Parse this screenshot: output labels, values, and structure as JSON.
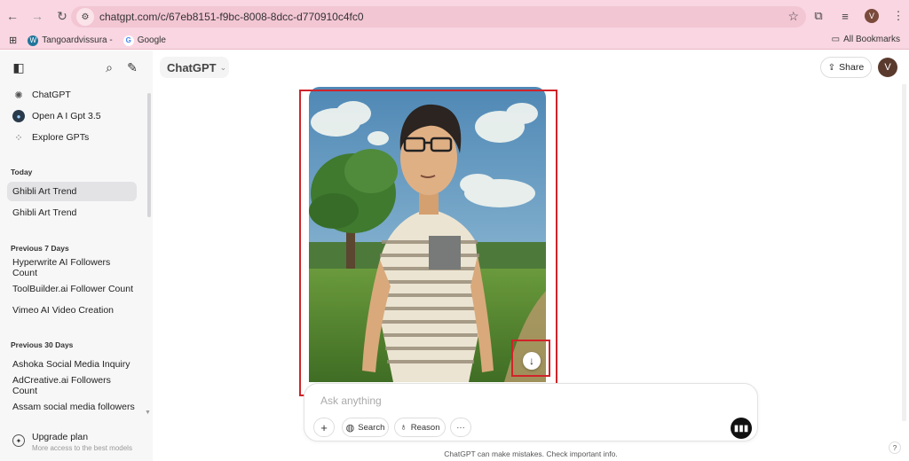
{
  "browser": {
    "url": "chatgpt.com/c/67eb8151-f9bc-8008-8dcc-d770910c4fc0",
    "profile_initial": "V",
    "bookmarks": [
      {
        "label": "Tangoardvissura -",
        "icon": "wordpress-icon",
        "color": "#21759b"
      },
      {
        "label": "Google",
        "icon": "google-icon",
        "color": "#4285f4"
      }
    ],
    "all_bookmarks_label": "All Bookmarks"
  },
  "sidebar": {
    "top_items": [
      {
        "label": "ChatGPT",
        "icon": "openai-icon"
      },
      {
        "label": "Open A I Gpt 3.5",
        "icon": "gpt-avatar-icon"
      },
      {
        "label": "Explore GPTs",
        "icon": "grid-icon"
      }
    ],
    "sections": [
      {
        "title": "Today",
        "items": [
          "Ghibli Art Trend",
          "Ghibli Art Trend"
        ]
      },
      {
        "title": "Previous 7 Days",
        "items": [
          "Hyperwrite AI Followers Count",
          "ToolBuilder.ai Follower Count",
          "Vimeo AI Video Creation"
        ]
      },
      {
        "title": "Previous 30 Days",
        "items": [
          "Ashoka Social Media Inquiry",
          "AdCreative.ai Followers Count",
          "Assam social media followers"
        ]
      }
    ],
    "upgrade": {
      "title": "Upgrade plan",
      "subtitle": "More access to the best models"
    }
  },
  "header": {
    "model": "ChatGPT",
    "share_label": "Share",
    "avatar_initial": "V"
  },
  "composer": {
    "placeholder": "Ask anything",
    "search_label": "Search",
    "reason_label": "Reason",
    "more_label": "···"
  },
  "disclaimer": "ChatGPT can make mistakes. Check important info.",
  "help_label": "?",
  "accent_colors": {
    "highlight": "#d0232a",
    "chrome": "#f9d6e1"
  }
}
